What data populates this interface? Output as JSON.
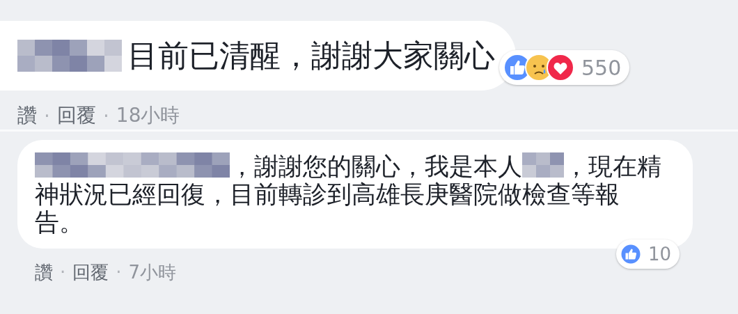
{
  "comments": [
    {
      "segments": [
        {
          "kind": "redacted"
        },
        {
          "kind": "text",
          "text": "目前已清醒，謝謝大家關心"
        }
      ],
      "reactions": [
        {
          "kind": "like"
        },
        {
          "kind": "sad"
        },
        {
          "kind": "love"
        }
      ],
      "reaction_count": "550",
      "actions": [
        {
          "kind": "link",
          "text": "讚"
        },
        {
          "kind": "separator",
          "text": "·"
        },
        {
          "kind": "link",
          "text": "回覆"
        },
        {
          "kind": "separator",
          "text": "·"
        },
        {
          "kind": "time",
          "text": "18小時"
        }
      ]
    },
    {
      "segments": [
        {
          "kind": "redacted"
        },
        {
          "kind": "text",
          "text": "，謝謝您的關心，我是本人"
        },
        {
          "kind": "redacted"
        },
        {
          "kind": "text",
          "text": "，現在精"
        },
        {
          "kind": "new_line",
          "text": "神狀況已經回復，目前轉診到高雄長庚醫院做檢查等報告。"
        }
      ],
      "reactions": [
        {
          "kind": "like"
        }
      ],
      "reaction_count": "10",
      "actions": [
        {
          "kind": "link",
          "text": "讚"
        },
        {
          "kind": "separator",
          "text": "·"
        },
        {
          "kind": "link",
          "text": "回覆"
        },
        {
          "kind": "separator",
          "text": "·"
        },
        {
          "kind": "time",
          "text": "7小時"
        }
      ]
    }
  ]
}
